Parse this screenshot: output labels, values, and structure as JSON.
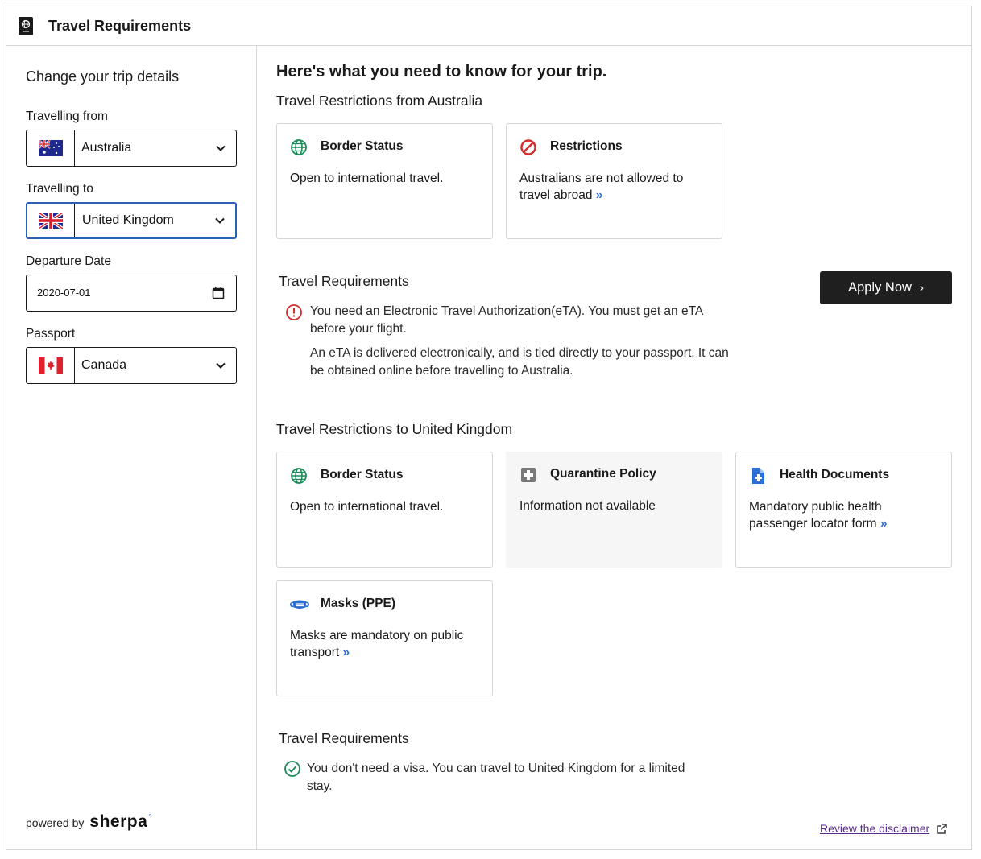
{
  "header": {
    "title": "Travel Requirements",
    "icon": "passport-icon"
  },
  "sidebar": {
    "heading": "Change your trip details",
    "from": {
      "label": "Travelling from",
      "value": "Australia",
      "flag": "australia-flag"
    },
    "to": {
      "label": "Travelling to",
      "value": "United Kingdom",
      "flag": "uk-flag"
    },
    "departure": {
      "label": "Departure Date",
      "value": "2020-07-01"
    },
    "passport": {
      "label": "Passport",
      "value": "Canada",
      "flag": "canada-flag"
    },
    "powered_by": "powered by",
    "brand": "sherpa",
    "brand_mark": "°"
  },
  "main": {
    "heading": "Here's what you need to know for your trip.",
    "from_section": {
      "title": "Travel Restrictions from Australia",
      "cards": [
        {
          "title": "Border Status",
          "text": "Open to international travel.",
          "icon": "globe-icon"
        },
        {
          "title": "Restrictions",
          "text": "Australians are not allowed to travel abroad",
          "more": "»",
          "icon": "no-entry-icon"
        }
      ]
    },
    "requirements_1": {
      "title": "Travel Requirements",
      "line1": "You need an Electronic Travel Authorization(eTA). You must get an eTA before your flight.",
      "line2": "An eTA is delivered electronically, and is tied directly to your passport. It can be obtained online before travelling to Australia.",
      "apply_label": "Apply Now",
      "apply_arrow": "›"
    },
    "to_section": {
      "title": "Travel Restrictions to United Kingdom",
      "cards": [
        {
          "title": "Border Status",
          "text": "Open to international travel.",
          "icon": "globe-icon"
        },
        {
          "title": "Quarantine Policy",
          "text": "Information not available",
          "icon": "medical-cross-icon"
        },
        {
          "title": "Health Documents",
          "text": "Mandatory public health passenger locator form",
          "more": "»",
          "icon": "health-document-icon"
        },
        {
          "title": "Masks (PPE)",
          "text": "Masks are mandatory on public transport",
          "more": "»",
          "icon": "mask-icon"
        }
      ]
    },
    "requirements_2": {
      "title": "Travel Requirements",
      "line1": "You don't need a visa. You can travel to United Kingdom for a limited stay."
    },
    "disclaimer": "Review the disclaimer"
  },
  "colors": {
    "accent_blue": "#2b6fd6",
    "green": "#1e8a5a",
    "red": "#d62b2b",
    "dark_button": "#1f1f1f",
    "focus_border": "#2b5fb8",
    "link_purple": "#5b2b8f"
  }
}
